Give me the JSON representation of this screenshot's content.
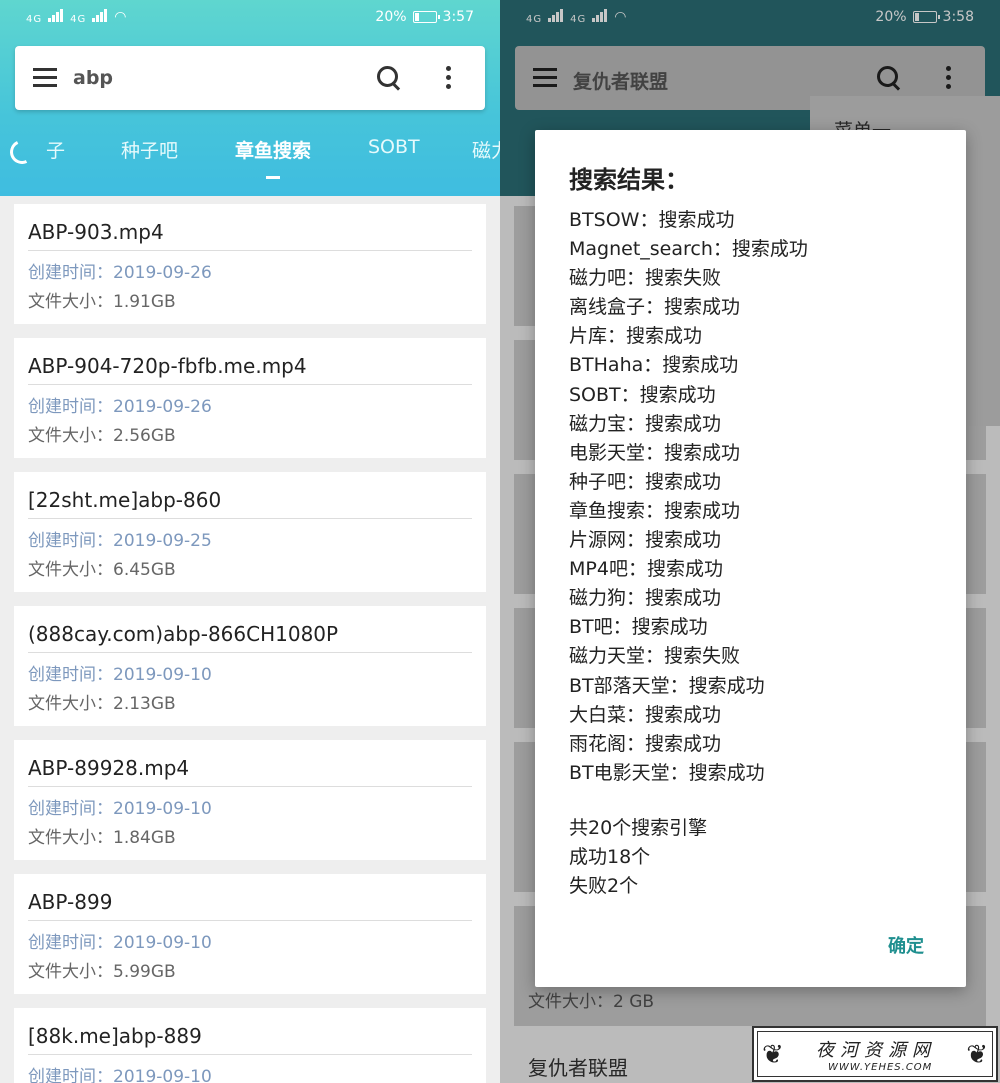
{
  "left": {
    "status": {
      "signal": "4G",
      "battery": "20%",
      "time": "3:57"
    },
    "search": {
      "query": "abp"
    },
    "tabs": [
      {
        "label": "子"
      },
      {
        "label": "种子吧"
      },
      {
        "label": "章鱼搜索"
      },
      {
        "label": "SOBT"
      },
      {
        "label": "磁力"
      }
    ],
    "results": [
      {
        "title": "ABP-903.mp4",
        "created": "创建时间：2019-09-26",
        "size": "文件大小：1.91GB"
      },
      {
        "title": "ABP-904-720p-fbfb.me.mp4",
        "created": "创建时间：2019-09-26",
        "size": "文件大小：2.56GB"
      },
      {
        "title": "[22sht.me]abp-860",
        "created": "创建时间：2019-09-25",
        "size": "文件大小：6.45GB"
      },
      {
        "title": "(888cay.com)abp-866CH1080P",
        "created": "创建时间：2019-09-10",
        "size": "文件大小：2.13GB"
      },
      {
        "title": "ABP-89928.mp4",
        "created": "创建时间：2019-09-10",
        "size": "文件大小：1.84GB"
      },
      {
        "title": "ABP-899",
        "created": "创建时间：2019-09-10",
        "size": "文件大小：5.99GB"
      },
      {
        "title": "[88k.me]abp-889",
        "created": "创建时间：2019-09-10",
        "size": ""
      }
    ]
  },
  "right": {
    "status": {
      "signal": "4G",
      "battery": "20%",
      "time": "3:58"
    },
    "search": {
      "query": "复仇者联盟"
    },
    "menu_item": "菜单一",
    "background_size": "文件大小：2 GB",
    "background_title": "复仇者联盟",
    "dialog": {
      "title": "搜索结果：",
      "lines": [
        "BTSOW：搜索成功",
        "Magnet_search：搜索成功",
        "磁力吧：搜索失败",
        "离线盒子：搜索成功",
        "片库：搜索成功",
        "BTHaha：搜索成功",
        "SOBT：搜索成功",
        "磁力宝：搜索成功",
        "电影天堂：搜索成功",
        "种子吧：搜索成功",
        "章鱼搜索：搜索成功",
        "片源网：搜索成功",
        "MP4吧：搜索成功",
        "磁力狗：搜索成功",
        "BT吧：搜索成功",
        "磁力天堂：搜索失败",
        "BT部落天堂：搜索成功",
        "大白菜：搜索成功",
        "雨花阁：搜索成功",
        "BT电影天堂：搜索成功"
      ],
      "summary": [
        "共20个搜索引擎",
        "成功18个",
        "失败2个"
      ],
      "ok_label": "确定"
    }
  },
  "watermark": {
    "title": "夜河资源网",
    "url": "WWW.YEHES.COM"
  },
  "colors": {
    "left_appbar": "#46c4da",
    "right_appbar": "#2b6e75",
    "accent": "#1f8f8f",
    "meta_text": "#7d98bd"
  },
  "icons": [
    "menu-icon",
    "search-icon",
    "more-vert-icon",
    "loading-spinner-icon",
    "wifi-icon",
    "battery-icon"
  ]
}
